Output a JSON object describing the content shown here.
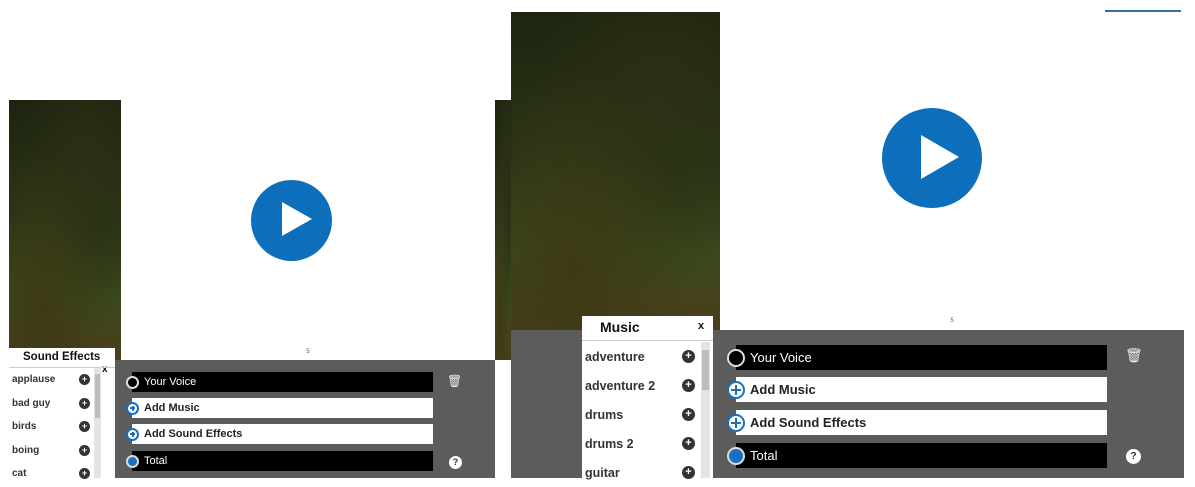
{
  "left": {
    "video_time": "5",
    "tracks": {
      "voice": "Your Voice",
      "music": "Add Music",
      "sfx": "Add Sound Effects",
      "total": "Total"
    },
    "trash_icon": "🗑",
    "help": "?",
    "panel": {
      "title": "Sound Effects",
      "close": "x",
      "items": [
        "applause",
        "bad guy",
        "birds",
        "boing",
        "cat"
      ]
    }
  },
  "right": {
    "video_time": "5",
    "tracks": {
      "voice": "Your Voice",
      "music": "Add Music",
      "sfx": "Add Sound Effects",
      "total": "Total"
    },
    "trash_icon": "🗑",
    "help": "?",
    "panel": {
      "title": "Music",
      "close": "x",
      "items": [
        "adventure",
        "adventure 2",
        "drums",
        "drums 2",
        "guitar"
      ]
    }
  },
  "colors": {
    "accent": "#0d6fbb",
    "dark_bar": "#5c5c5c",
    "tab": "#3a6aa5"
  }
}
